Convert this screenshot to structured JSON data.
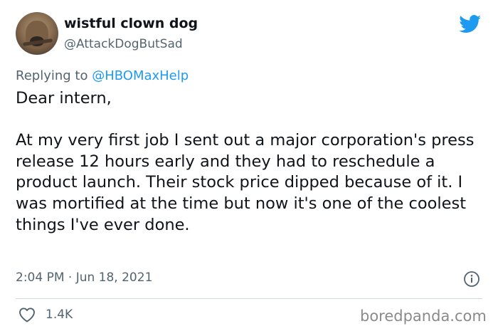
{
  "user": {
    "display_name": "wistful clown dog",
    "handle": "@AttackDogButSad"
  },
  "reply": {
    "prefix": "Replying to ",
    "to": "@HBOMaxHelp"
  },
  "tweet": {
    "text": "Dear intern,\n\nAt my very first job I sent out a major corporation's press release 12 hours early and they had to reschedule a product launch. Their stock price dipped because of it. I was mortified at the time but now it's one of the coolest things I've ever done."
  },
  "meta": {
    "timestamp": "2:04 PM · Jun 18, 2021"
  },
  "actions": {
    "like_count": "1.4K"
  },
  "watermark": "boredpanda.com",
  "icons": {
    "brand": "twitter-bird-icon",
    "info": "info-icon",
    "like": "heart-icon"
  },
  "colors": {
    "accent": "#1d9bf0",
    "text": "#0f1419",
    "secondary": "#536471"
  }
}
